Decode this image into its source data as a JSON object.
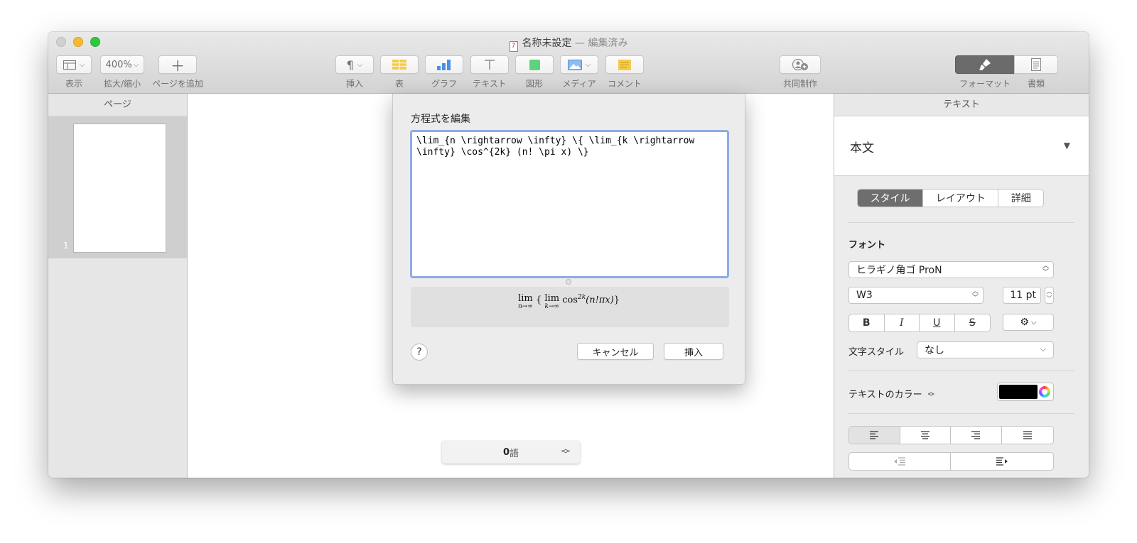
{
  "window": {
    "title": "名称未設定",
    "title_suffix": "— 編集済み",
    "doc_icon_glyph": "7"
  },
  "toolbar": {
    "view_label": "表示",
    "zoom_value": "400%",
    "zoom_label": "拡大/縮小",
    "add_page_label": "ページを追加",
    "insert_label": "挿入",
    "table_label": "表",
    "chart_label": "グラフ",
    "text_label": "テキスト",
    "shape_label": "図形",
    "media_label": "メディア",
    "comment_label": "コメント",
    "collaborate_label": "共同制作",
    "format_label": "フォーマット",
    "document_label": "書類"
  },
  "sidebar": {
    "header": "ページ",
    "pages": [
      {
        "number": "1"
      }
    ]
  },
  "canvas": {
    "word_count_value": "0",
    "word_count_unit": "語"
  },
  "dialog": {
    "title": "方程式を編集",
    "equation_text": "\\lim_{n \\rightarrow \\infty} \\{ \\lim_{k \\rightarrow \\infty} \\cos^{2k} (n! \\pi x) \\}",
    "preview": {
      "lim": "lim",
      "lim_sub_n": "n→∞",
      "lim_sub_k": "k→∞",
      "lbrace": "{",
      "rbrace": "}",
      "cos": "cos",
      "exponent": "2k",
      "argument": "(n!πx)"
    },
    "help_label": "?",
    "cancel_label": "キャンセル",
    "insert_label": "挿入"
  },
  "inspector": {
    "header": "テキスト",
    "paragraph_style": "本文",
    "tabs": [
      "スタイル",
      "レイアウト",
      "詳細"
    ],
    "active_tab": "スタイル",
    "font_section_label": "フォント",
    "font_family": "ヒラギノ角ゴ ProN",
    "font_weight": "W3",
    "font_size": "11 pt",
    "char_style_label": "文字スタイル",
    "char_style_value": "なし",
    "text_color_label": "テキストのカラー",
    "text_color": "#000000"
  },
  "colors": {
    "focus_ring": "#8eabe8",
    "traffic_close": "#d0d0d0",
    "traffic_min": "#f6bb31",
    "traffic_max": "#2fc840",
    "active_segment": "#6e6e6e"
  }
}
